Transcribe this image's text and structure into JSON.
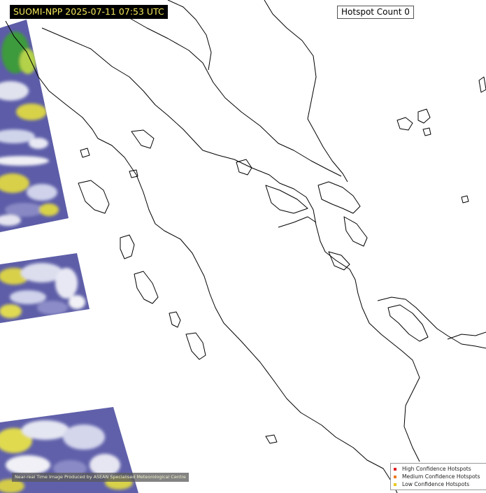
{
  "header": {
    "title": "SUOMI-NPP 2025-07-11 07:53 UTC",
    "hotspot_count_label": "Hotspot Count 0"
  },
  "credit": {
    "text": "Near-real Time Image Produced by ASEAN Specialised Meteorological Centre"
  },
  "legend": {
    "items": [
      {
        "label": "High Confidence Hotspots",
        "color": "#e02020"
      },
      {
        "label": "Medium Confidence Hotspots",
        "color": "#f07a20"
      },
      {
        "label": "Low Confidence Hotspots",
        "color": "#e8c820"
      }
    ]
  },
  "colors": {
    "coastline": "#000000",
    "cloud_blue": "#6a6ab8",
    "cloud_white": "#e6e8f2",
    "cloud_yellow": "#d8d248",
    "vegetation_green": "#3a9a3a"
  }
}
